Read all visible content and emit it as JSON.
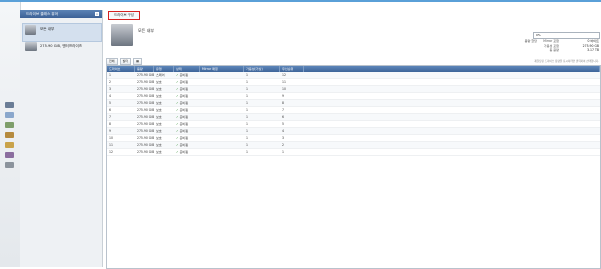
{
  "sidebar": {
    "header": "드라이브 클래스 뷰어",
    "items": [
      {
        "label": "모든 내부",
        "icon": "disk-stack-icon"
      },
      {
        "label": "275.90 GiB, 엔터프라이즈",
        "icon": "disk-drive-icon"
      }
    ]
  },
  "toolbar": {
    "active_tab": "드라이브 구성",
    "page_title": "모든 내부",
    "buttons": [
      "전체",
      "필터"
    ]
  },
  "progress": {
    "label": "0%",
    "value": 0
  },
  "stats": [
    {
      "label": "용량 할당",
      "sub": "Mirror 포함",
      "value": "0 바이트"
    },
    {
      "label": "",
      "sub": "가용성 포함",
      "value": "275.90 GB"
    },
    {
      "label": "",
      "sub": "총 용량",
      "value": "3.17 TB"
    }
  ],
  "note": "재할당된 드라이브 용량을 표시하려면 클릭하여 선택합니다.",
  "table": {
    "columns": [
      "드라이브",
      "용량",
      "유형",
      "상태",
      "Mirror 매칭",
      "가용성(가상)",
      "우선순위"
    ],
    "rows": [
      [
        "1",
        "275.90 GiB",
        "스페어",
        "준비됨",
        "1",
        "12"
      ],
      [
        "2",
        "275.90 GiB",
        "보호",
        "준비됨",
        "1",
        "11"
      ],
      [
        "3",
        "275.90 GiB",
        "보호",
        "준비됨",
        "1",
        "10"
      ],
      [
        "4",
        "275.90 GiB",
        "보호",
        "준비됨",
        "1",
        "9"
      ],
      [
        "5",
        "275.90 GiB",
        "보호",
        "준비됨",
        "1",
        "8"
      ],
      [
        "6",
        "275.90 GiB",
        "보호",
        "준비됨",
        "1",
        "7"
      ],
      [
        "7",
        "275.90 GiB",
        "보호",
        "준비됨",
        "1",
        "6"
      ],
      [
        "8",
        "275.90 GiB",
        "보호",
        "준비됨",
        "1",
        "5"
      ],
      [
        "9",
        "275.90 GiB",
        "보호",
        "준비됨",
        "1",
        "4"
      ],
      [
        "10",
        "275.90 GiB",
        "보호",
        "준비됨",
        "1",
        "3"
      ],
      [
        "11",
        "275.90 GiB",
        "보호",
        "준비됨",
        "1",
        "2"
      ],
      [
        "12",
        "275.90 GiB",
        "보호",
        "준비됨",
        "1",
        "1"
      ]
    ]
  },
  "left_icons": [
    "computer-icon",
    "network-icon",
    "storage-icon",
    "chart-icon",
    "folder-icon",
    "user-icon",
    "gear-icon"
  ],
  "colors": {
    "accent": "#3c6196",
    "highlight": "#d62020",
    "check": "#2a8a2a"
  }
}
